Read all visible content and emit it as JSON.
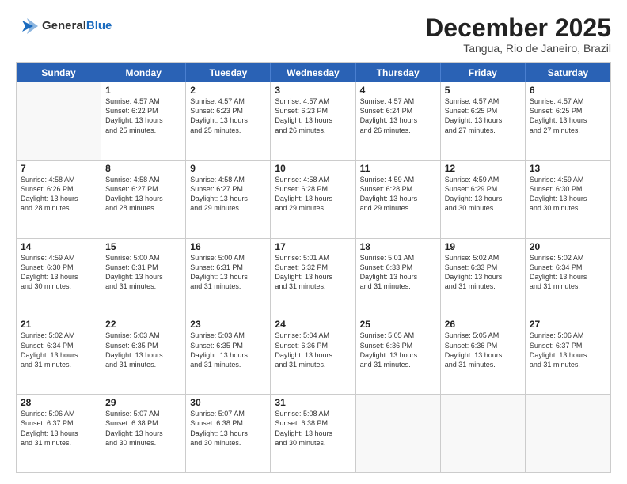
{
  "header": {
    "logo_general": "General",
    "logo_blue": "Blue",
    "month": "December 2025",
    "location": "Tangua, Rio de Janeiro, Brazil"
  },
  "days_of_week": [
    "Sunday",
    "Monday",
    "Tuesday",
    "Wednesday",
    "Thursday",
    "Friday",
    "Saturday"
  ],
  "weeks": [
    [
      {
        "day": "",
        "lines": []
      },
      {
        "day": "1",
        "lines": [
          "Sunrise: 4:57 AM",
          "Sunset: 6:22 PM",
          "Daylight: 13 hours",
          "and 25 minutes."
        ]
      },
      {
        "day": "2",
        "lines": [
          "Sunrise: 4:57 AM",
          "Sunset: 6:23 PM",
          "Daylight: 13 hours",
          "and 25 minutes."
        ]
      },
      {
        "day": "3",
        "lines": [
          "Sunrise: 4:57 AM",
          "Sunset: 6:23 PM",
          "Daylight: 13 hours",
          "and 26 minutes."
        ]
      },
      {
        "day": "4",
        "lines": [
          "Sunrise: 4:57 AM",
          "Sunset: 6:24 PM",
          "Daylight: 13 hours",
          "and 26 minutes."
        ]
      },
      {
        "day": "5",
        "lines": [
          "Sunrise: 4:57 AM",
          "Sunset: 6:25 PM",
          "Daylight: 13 hours",
          "and 27 minutes."
        ]
      },
      {
        "day": "6",
        "lines": [
          "Sunrise: 4:57 AM",
          "Sunset: 6:25 PM",
          "Daylight: 13 hours",
          "and 27 minutes."
        ]
      }
    ],
    [
      {
        "day": "7",
        "lines": [
          "Sunrise: 4:58 AM",
          "Sunset: 6:26 PM",
          "Daylight: 13 hours",
          "and 28 minutes."
        ]
      },
      {
        "day": "8",
        "lines": [
          "Sunrise: 4:58 AM",
          "Sunset: 6:27 PM",
          "Daylight: 13 hours",
          "and 28 minutes."
        ]
      },
      {
        "day": "9",
        "lines": [
          "Sunrise: 4:58 AM",
          "Sunset: 6:27 PM",
          "Daylight: 13 hours",
          "and 29 minutes."
        ]
      },
      {
        "day": "10",
        "lines": [
          "Sunrise: 4:58 AM",
          "Sunset: 6:28 PM",
          "Daylight: 13 hours",
          "and 29 minutes."
        ]
      },
      {
        "day": "11",
        "lines": [
          "Sunrise: 4:59 AM",
          "Sunset: 6:28 PM",
          "Daylight: 13 hours",
          "and 29 minutes."
        ]
      },
      {
        "day": "12",
        "lines": [
          "Sunrise: 4:59 AM",
          "Sunset: 6:29 PM",
          "Daylight: 13 hours",
          "and 30 minutes."
        ]
      },
      {
        "day": "13",
        "lines": [
          "Sunrise: 4:59 AM",
          "Sunset: 6:30 PM",
          "Daylight: 13 hours",
          "and 30 minutes."
        ]
      }
    ],
    [
      {
        "day": "14",
        "lines": [
          "Sunrise: 4:59 AM",
          "Sunset: 6:30 PM",
          "Daylight: 13 hours",
          "and 30 minutes."
        ]
      },
      {
        "day": "15",
        "lines": [
          "Sunrise: 5:00 AM",
          "Sunset: 6:31 PM",
          "Daylight: 13 hours",
          "and 31 minutes."
        ]
      },
      {
        "day": "16",
        "lines": [
          "Sunrise: 5:00 AM",
          "Sunset: 6:31 PM",
          "Daylight: 13 hours",
          "and 31 minutes."
        ]
      },
      {
        "day": "17",
        "lines": [
          "Sunrise: 5:01 AM",
          "Sunset: 6:32 PM",
          "Daylight: 13 hours",
          "and 31 minutes."
        ]
      },
      {
        "day": "18",
        "lines": [
          "Sunrise: 5:01 AM",
          "Sunset: 6:33 PM",
          "Daylight: 13 hours",
          "and 31 minutes."
        ]
      },
      {
        "day": "19",
        "lines": [
          "Sunrise: 5:02 AM",
          "Sunset: 6:33 PM",
          "Daylight: 13 hours",
          "and 31 minutes."
        ]
      },
      {
        "day": "20",
        "lines": [
          "Sunrise: 5:02 AM",
          "Sunset: 6:34 PM",
          "Daylight: 13 hours",
          "and 31 minutes."
        ]
      }
    ],
    [
      {
        "day": "21",
        "lines": [
          "Sunrise: 5:02 AM",
          "Sunset: 6:34 PM",
          "Daylight: 13 hours",
          "and 31 minutes."
        ]
      },
      {
        "day": "22",
        "lines": [
          "Sunrise: 5:03 AM",
          "Sunset: 6:35 PM",
          "Daylight: 13 hours",
          "and 31 minutes."
        ]
      },
      {
        "day": "23",
        "lines": [
          "Sunrise: 5:03 AM",
          "Sunset: 6:35 PM",
          "Daylight: 13 hours",
          "and 31 minutes."
        ]
      },
      {
        "day": "24",
        "lines": [
          "Sunrise: 5:04 AM",
          "Sunset: 6:36 PM",
          "Daylight: 13 hours",
          "and 31 minutes."
        ]
      },
      {
        "day": "25",
        "lines": [
          "Sunrise: 5:05 AM",
          "Sunset: 6:36 PM",
          "Daylight: 13 hours",
          "and 31 minutes."
        ]
      },
      {
        "day": "26",
        "lines": [
          "Sunrise: 5:05 AM",
          "Sunset: 6:36 PM",
          "Daylight: 13 hours",
          "and 31 minutes."
        ]
      },
      {
        "day": "27",
        "lines": [
          "Sunrise: 5:06 AM",
          "Sunset: 6:37 PM",
          "Daylight: 13 hours",
          "and 31 minutes."
        ]
      }
    ],
    [
      {
        "day": "28",
        "lines": [
          "Sunrise: 5:06 AM",
          "Sunset: 6:37 PM",
          "Daylight: 13 hours",
          "and 31 minutes."
        ]
      },
      {
        "day": "29",
        "lines": [
          "Sunrise: 5:07 AM",
          "Sunset: 6:38 PM",
          "Daylight: 13 hours",
          "and 30 minutes."
        ]
      },
      {
        "day": "30",
        "lines": [
          "Sunrise: 5:07 AM",
          "Sunset: 6:38 PM",
          "Daylight: 13 hours",
          "and 30 minutes."
        ]
      },
      {
        "day": "31",
        "lines": [
          "Sunrise: 5:08 AM",
          "Sunset: 6:38 PM",
          "Daylight: 13 hours",
          "and 30 minutes."
        ]
      },
      {
        "day": "",
        "lines": []
      },
      {
        "day": "",
        "lines": []
      },
      {
        "day": "",
        "lines": []
      }
    ]
  ]
}
